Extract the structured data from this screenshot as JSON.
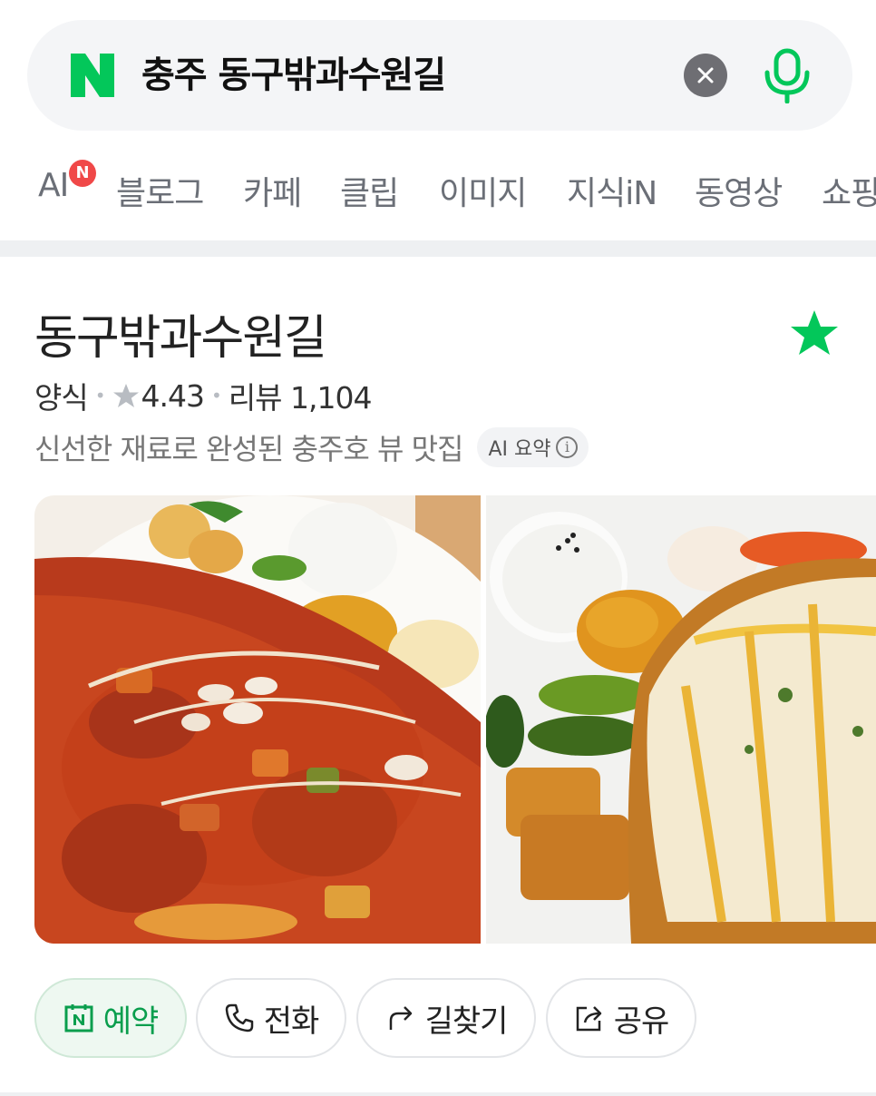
{
  "search": {
    "query": "충주 동구밖과수원길"
  },
  "tabs": [
    {
      "label": "AI",
      "badge": "N"
    },
    {
      "label": "블로그"
    },
    {
      "label": "카페"
    },
    {
      "label": "클립"
    },
    {
      "label": "이미지"
    },
    {
      "label": "지식iN"
    },
    {
      "label": "동영상"
    },
    {
      "label": "쇼핑"
    }
  ],
  "place": {
    "name": "동구밖과수원길",
    "category": "양식",
    "rating": "4.43",
    "reviews_label": "리뷰 1,104",
    "description": "신선한 재료로 완성된 충주호 뷰 맛집",
    "ai_summary_label": "AI 요약",
    "info_glyph": "i"
  },
  "actions": [
    {
      "label": "예약",
      "icon": "naver-booking-icon"
    },
    {
      "label": "전화",
      "icon": "phone-icon"
    },
    {
      "label": "길찾기",
      "icon": "directions-icon"
    },
    {
      "label": "공유",
      "icon": "share-icon"
    }
  ],
  "colors": {
    "brand_green": "#03c75a",
    "badge_red": "#f04848",
    "star_gray": "#b8bcc2"
  }
}
